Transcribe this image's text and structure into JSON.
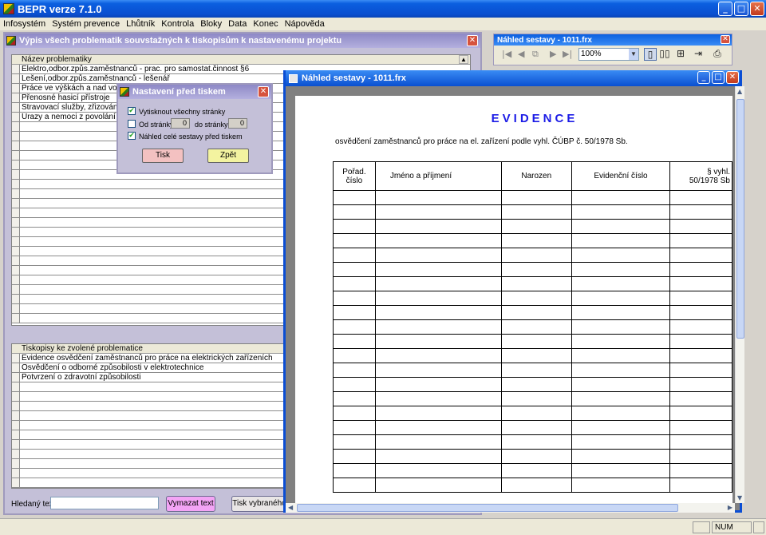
{
  "app": {
    "title": "BEPR verze 7.1.0",
    "menu": [
      "Infosystém",
      "Systém prevence",
      "Lhůtník",
      "Kontrola",
      "Bloky",
      "Data",
      "Konec",
      "Nápověda"
    ]
  },
  "vypis": {
    "title": "Výpis všech problematik souvstažných k tiskopisům k nastavenému projektu",
    "top_header": "Název problematiky",
    "top_rows": [
      "Elektro,odbor.způs.zaměstnanců - prac. pro samostat.činnost §6",
      "Lešení,odbor.způs.zaměstnanců - lešenář",
      "Práce ve výškách a nad volnou hl",
      "Přenosné hasicí přístroje",
      "Stravovací služby, zřizování a pro",
      "Úrazy a nemoci z povolání - povinn"
    ],
    "bottom_header": "Tiskopisy ke zvolené problematice",
    "bottom_rows": [
      "Evidence osvědčení zaměstnanců pro práce na elektrických zařízeních",
      "Osvědčení o odborné způsobilosti v elektrotechnice",
      "Potvrzení o zdravotní způsobilosti"
    ],
    "search_label": "Hledaný text",
    "search_value": "",
    "btn_clear": "Vymazat text",
    "btn_print_selected": "Tisk vybraného"
  },
  "dialog": {
    "title": "Nastavení před tiskem",
    "chk_all": "Vytisknout všechny stránky",
    "chk_all_checked": true,
    "from_label": "Od stránky",
    "from_value": "0",
    "to_label": "do stránky",
    "to_value": "0",
    "chk_range_checked": false,
    "chk_preview": "Náhled celé sestavy před tiskem",
    "chk_preview_checked": true,
    "btn_print": "Tisk",
    "btn_back": "Zpět"
  },
  "toolbar": {
    "title": "Náhled sestavy - 1011.frx",
    "zoom": "100%",
    "icons": [
      "first-page-icon",
      "prev-page-icon",
      "copy-icon",
      "next-page-icon",
      "last-page-icon",
      "one-page-icon",
      "two-page-icon",
      "multi-page-icon",
      "exit-icon",
      "printer-icon"
    ]
  },
  "preview": {
    "title": "Náhled sestavy - 1011.frx",
    "report_title": "EVIDENCE",
    "report_subtitle": "osvědčení zaměstnanců pro práce na el. zařízení podle vyhl. ČÚBP č. 50/1978 Sb.",
    "columns": [
      "Pořad.\nčíslo",
      "Jméno a příjmení",
      "Narozen",
      "Evidenční číslo",
      "§ vyhl.\n50/1978 Sb"
    ],
    "empty_rows": 21
  },
  "status": {
    "num": "NUM"
  },
  "colors": {
    "title_blue": "#0a4fd0",
    "child_purple": "#9f9abd",
    "report_title": "#1b1be6",
    "btn_clear": "#f3a4f5",
    "btn_print": "#f3c1c1",
    "btn_back": "#f3f3a0"
  }
}
